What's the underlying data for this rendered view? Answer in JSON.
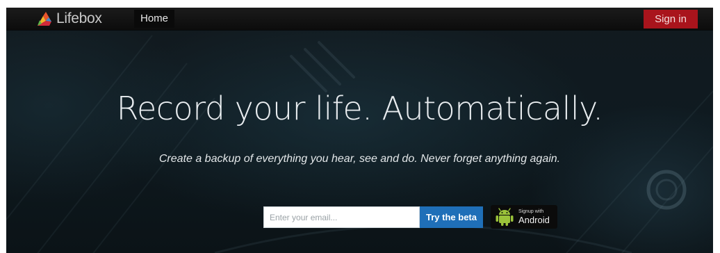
{
  "navbar": {
    "brand_name": "Lifebox",
    "home_label": "Home",
    "signin_label": "Sign in"
  },
  "hero": {
    "title": "Record your life. Automatically.",
    "subtitle": "Create a backup of everything you hear, see and do. Never forget anything again."
  },
  "signup": {
    "email_placeholder": "Enter your email...",
    "try_button_label": "Try the beta",
    "android_small_label": "Signup with",
    "android_big_label": "Android"
  },
  "colors": {
    "signin_background": "#a9141c",
    "try_button_background": "#1f6fb8",
    "android_green": "#9bc33a"
  },
  "icons": {
    "brand_logo": "lifebox-logo-icon",
    "android": "android-robot-icon"
  }
}
